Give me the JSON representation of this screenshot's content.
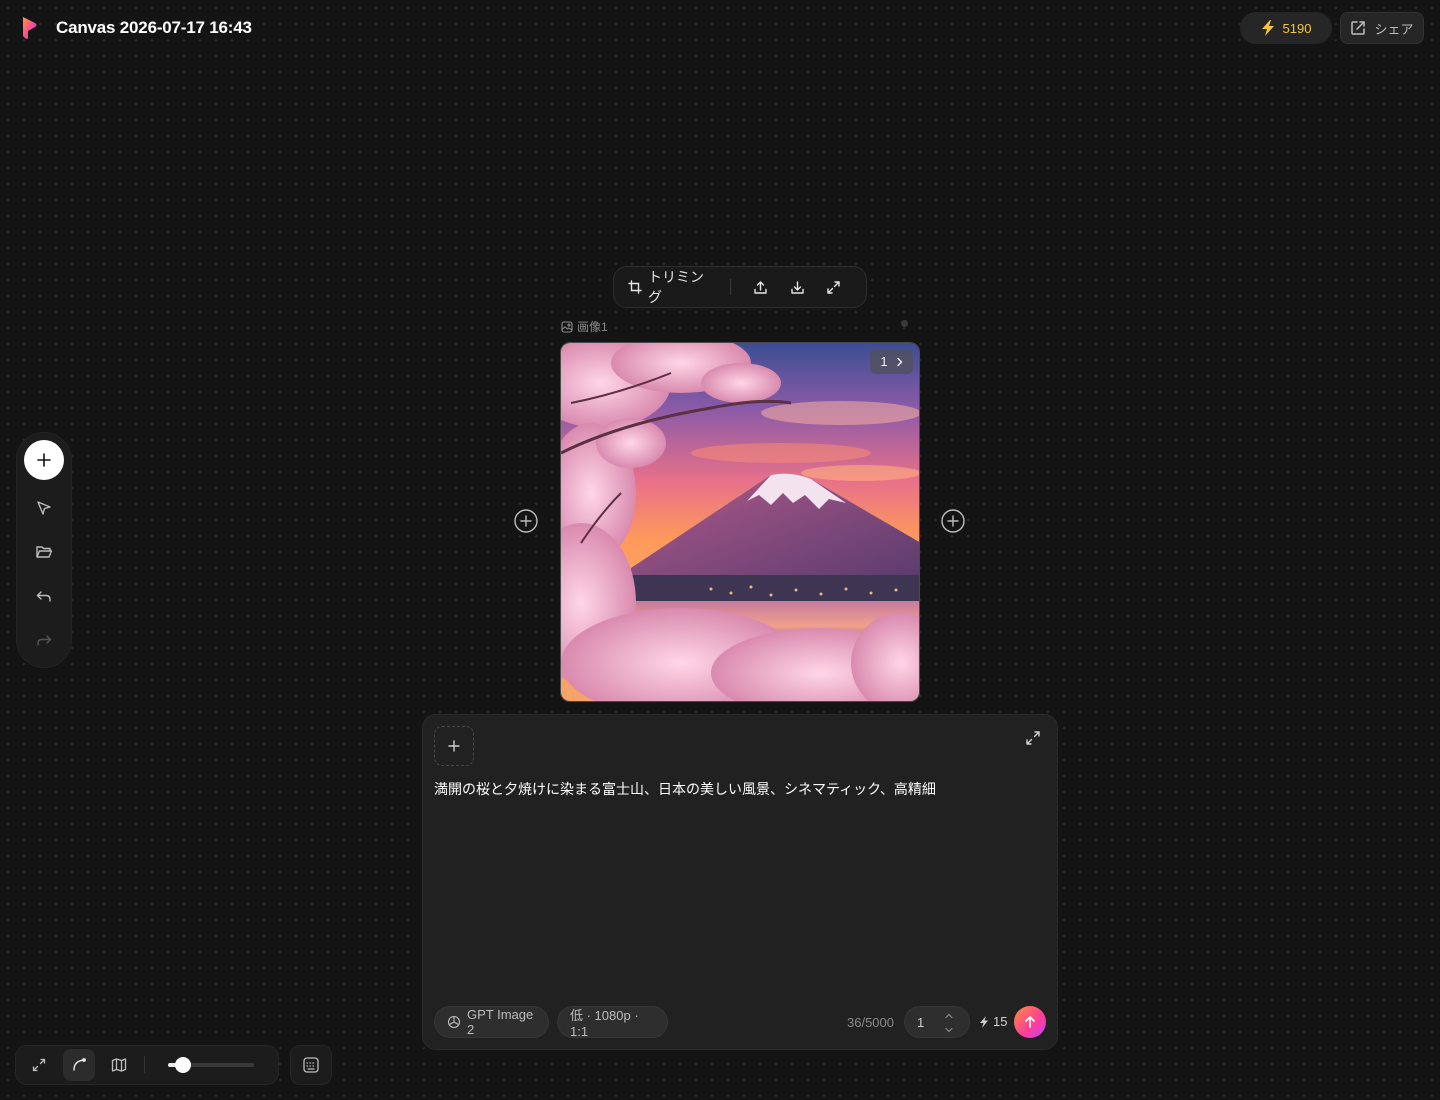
{
  "header": {
    "title": "Canvas 2026-07-17 16:43",
    "credits": "5190",
    "share_label": "シェア"
  },
  "left_toolbar": {
    "items": [
      "add-icon",
      "pointer-icon",
      "folder-icon",
      "undo-icon",
      "redo-icon"
    ]
  },
  "image_toolbar": {
    "crop_label": "トリミング"
  },
  "image_node": {
    "label": "画像1",
    "counter": "1"
  },
  "prompt": {
    "text": "満開の桜と夕焼けに染まる富士山、日本の美しい風景、シネマティック、高精細",
    "model": "GPT Image 2",
    "settings": "低 · 1080p · 1:1",
    "char_count": "36/5000",
    "quantity": "1",
    "cost": "15"
  },
  "bottom_toolbar": {
    "zoom_level_fraction": 0.17
  },
  "colors": {
    "accent_credit": "#f5c542",
    "send_gradient_start": "#ff8a3d",
    "send_gradient_end": "#c042ff",
    "background": "#141414"
  }
}
